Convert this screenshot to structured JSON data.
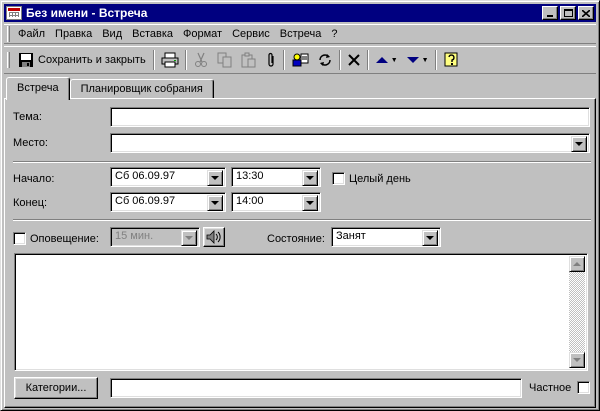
{
  "window": {
    "title": "Без имени - Встреча"
  },
  "menu": [
    {
      "label": "Файл"
    },
    {
      "label": "Правка"
    },
    {
      "label": "Вид"
    },
    {
      "label": "Вставка"
    },
    {
      "label": "Формат"
    },
    {
      "label": "Сервис"
    },
    {
      "label": "Встреча"
    },
    {
      "label": "?"
    }
  ],
  "toolbar": {
    "save_close_label": "Сохранить и закрыть"
  },
  "tabs": [
    {
      "label": "Встреча",
      "active": true
    },
    {
      "label": "Планировщик собрания",
      "active": false
    }
  ],
  "form": {
    "subject_label": "Тема:",
    "subject_value": "",
    "location_label": "Место:",
    "location_value": "",
    "start_label": "Начало:",
    "start_date": "Сб 06.09.97",
    "start_time": "13:30",
    "all_day_label": "Целый день",
    "end_label": "Конец:",
    "end_date": "Сб 06.09.97",
    "end_time": "14:00",
    "reminder_label": "Оповещение:",
    "reminder_value": "15 мин.",
    "status_label": "Состояние:",
    "status_value": "Занят",
    "categories_button": "Категории...",
    "categories_value": "",
    "private_label": "Частное"
  },
  "colors": {
    "titlebar": "#000080",
    "face": "#c0c0c0"
  }
}
